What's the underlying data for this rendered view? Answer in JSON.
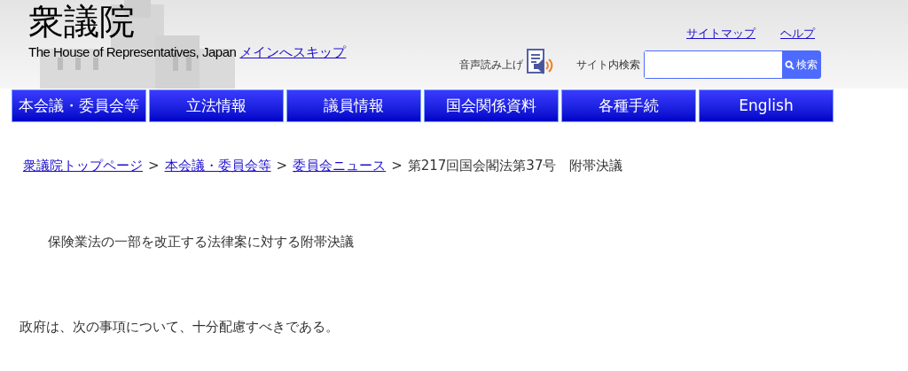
{
  "header": {
    "logo_title": "衆議院",
    "logo_subtitle": "The House of Representatives, Japan",
    "skip_link": "メインへスキップ",
    "links": [
      "サイトマップ",
      "ヘルプ"
    ],
    "speech_label": "音声読み上げ",
    "search_label": "サイト内検索",
    "search_button": "検索"
  },
  "nav": [
    "本会議・委員会等",
    "立法情報",
    "議員情報",
    "国会関係資料",
    "各種手続",
    "English"
  ],
  "breadcrumb": [
    {
      "label": "衆議院トップページ",
      "kind": "link"
    },
    {
      "label": ">",
      "kind": "separator"
    },
    {
      "label": "本会議・委員会等",
      "kind": "link"
    },
    {
      "label": ">",
      "kind": "separator"
    },
    {
      "label": "委員会ニュース",
      "kind": "link"
    },
    {
      "label": ">",
      "kind": "separator"
    },
    {
      "label": "第217回国会閣法第37号　附帯決議",
      "kind": "text"
    }
  ],
  "title": "保険業法の一部を改正する法律案に対する附帯決議",
  "body": "政府は、次の事項について、十分配慮すべきである。"
}
